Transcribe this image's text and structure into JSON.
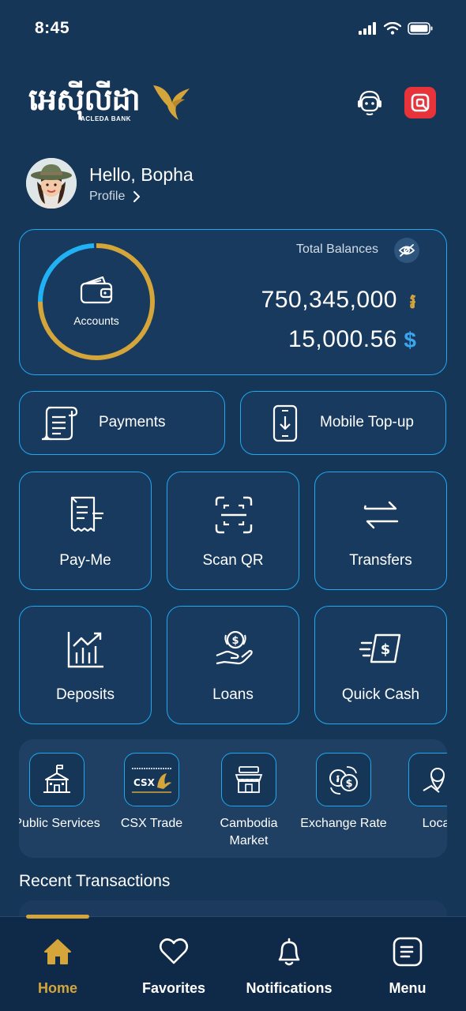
{
  "status": {
    "time": "8:45"
  },
  "brand": {
    "khmer_name": "អេស៊ីលីដា",
    "english_name": "ACLEDA BANK",
    "accent": "#d4a53a"
  },
  "profile": {
    "greeting": "Hello, Bopha",
    "link_label": "Profile"
  },
  "balance": {
    "total_label": "Total Balances",
    "accounts_label": "Accounts",
    "riel_amount": "750,345,000",
    "riel_symbol": "៛",
    "usd_amount": "15,000.56",
    "usd_symbol": "$"
  },
  "quick_actions": [
    {
      "label": "Payments",
      "icon": "receipt-scroll-icon"
    },
    {
      "label": "Mobile Top-up",
      "icon": "mobile-download-icon"
    }
  ],
  "tiles": [
    {
      "label": "Pay-Me",
      "icon": "receipt-icon"
    },
    {
      "label": "Scan QR",
      "icon": "scan-qr-icon"
    },
    {
      "label": "Transfers",
      "icon": "transfer-arrows-icon"
    },
    {
      "label": "Deposits",
      "icon": "growth-chart-icon"
    },
    {
      "label": "Loans",
      "icon": "hand-coin-icon"
    },
    {
      "label": "Quick Cash",
      "icon": "fast-cash-icon"
    }
  ],
  "services": [
    {
      "label": "Public Services",
      "icon": "government-building-icon"
    },
    {
      "label": "CSX Trade",
      "icon": "csx-logo-icon",
      "logo_text": "CSX"
    },
    {
      "label": "Cambodia Market",
      "icon": "market-store-icon"
    },
    {
      "label": "Exchange Rate",
      "icon": "currency-exchange-icon"
    },
    {
      "label": "Loca",
      "icon": "location-pin-icon"
    }
  ],
  "recent": {
    "title": "Recent Transactions"
  },
  "nav": [
    {
      "label": "Home",
      "icon": "home-icon",
      "active": true
    },
    {
      "label": "Favorites",
      "icon": "heart-icon",
      "active": false
    },
    {
      "label": "Notifications",
      "icon": "bell-icon",
      "active": false
    },
    {
      "label": "Menu",
      "icon": "menu-list-icon",
      "active": false
    }
  ],
  "colors": {
    "background": "#163658",
    "card_border": "#1fa9f0",
    "gold": "#d4a53a",
    "usd_blue": "#3aa6f0",
    "qr_red": "#e8333a"
  }
}
